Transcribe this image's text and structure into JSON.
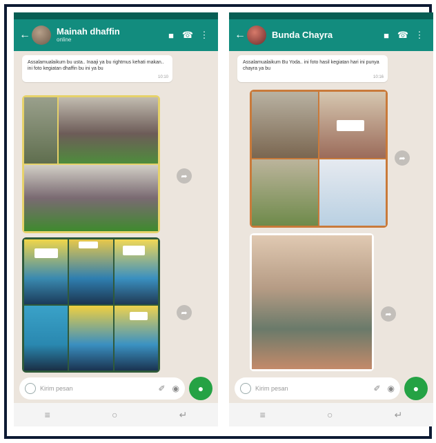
{
  "left": {
    "contact_name": "Mainah dhaffin",
    "contact_status": "online",
    "message_text": "Assalamualaikum bu usta.. Inaaji ya bu rightmus kehati makan.. ini foto kegiatan dhaffin bu ini ya bu",
    "message_time": "10:10",
    "input_placeholder": "Kirim pesan"
  },
  "right": {
    "contact_name": "Bunda Chayra",
    "message_text": "Assalamualaikum Bu Yoda.. ini foto hasil kegiatan hari ini punya chayra ya bu",
    "message_time": "10:16",
    "input_placeholder": "Kirim pesan"
  },
  "icons": {
    "back": "←",
    "video": "■",
    "call": "☎",
    "menu": "⋮",
    "forward": "➦",
    "clip": "✐",
    "camera": "◉",
    "mic": "●",
    "nav_recents": "≡",
    "nav_home": "○",
    "nav_back": "↵"
  },
  "colors": {
    "header": "#128c7e",
    "mic": "#25a244",
    "chat_bg": "#ece5dd",
    "frame": "#0d1a33"
  }
}
